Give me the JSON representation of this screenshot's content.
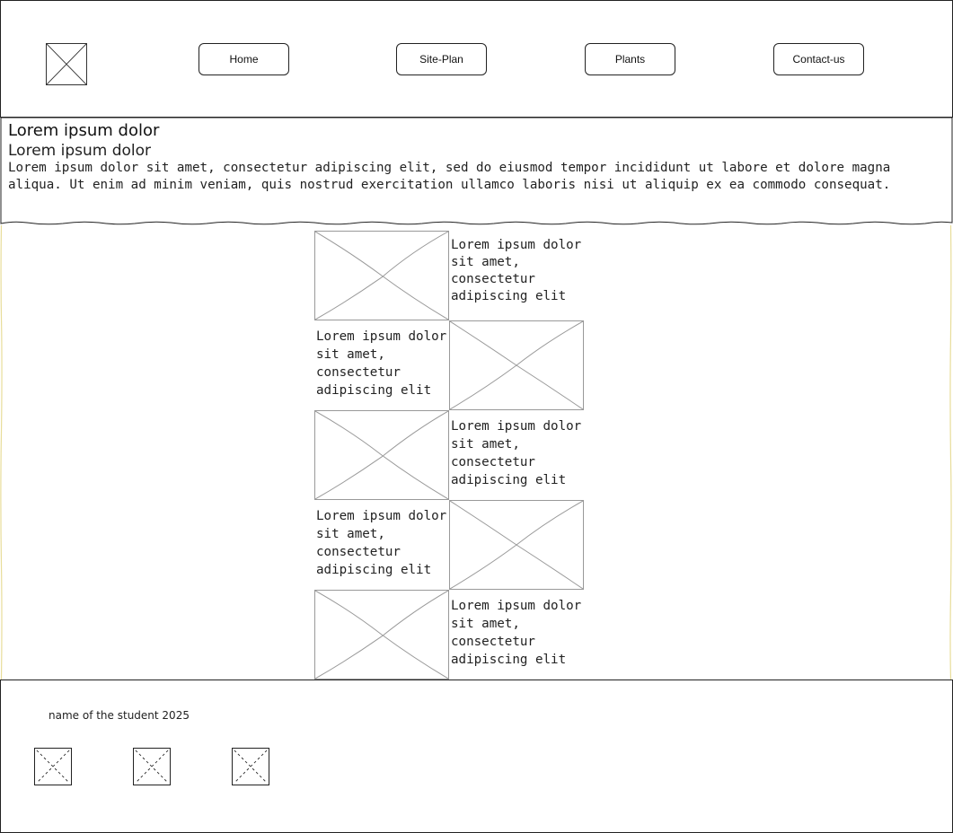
{
  "nav": {
    "items": [
      {
        "label": "Home"
      },
      {
        "label": "Site-Plan"
      },
      {
        "label": "Plants"
      },
      {
        "label": "Contact-us"
      }
    ]
  },
  "hero": {
    "title": "Lorem ipsum dolor",
    "subtitle": "Lorem ipsum dolor",
    "text": "Lorem ipsum dolor sit amet, consectetur adipiscing elit, sed do eiusmod tempor incididunt ut labore et dolore magna aliqua. Ut enim ad minim veniam, quis nostrud exercitation ullamco laboris nisi ut aliquip ex ea commodo consequat."
  },
  "grid": {
    "rows": [
      {
        "text": "Lorem ipsum dolor sit amet, consectetur adipiscing elit"
      },
      {
        "text": "Lorem ipsum dolor sit amet, consectetur adipiscing elit"
      },
      {
        "text": "Lorem ipsum dolor sit amet, consectetur adipiscing elit"
      },
      {
        "text": "Lorem ipsum dolor sit amet, consectetur adipiscing elit"
      },
      {
        "text": "Lorem ipsum dolor sit amet, consectetur adipiscing elit"
      }
    ]
  },
  "footer": {
    "text": "name of the student 2025",
    "icons": [
      "placeholder-icon",
      "placeholder-icon",
      "placeholder-icon"
    ]
  },
  "colors": {
    "border": "#222222",
    "placeholder": "#999999",
    "edge_yellow": "#e8dd9a"
  }
}
